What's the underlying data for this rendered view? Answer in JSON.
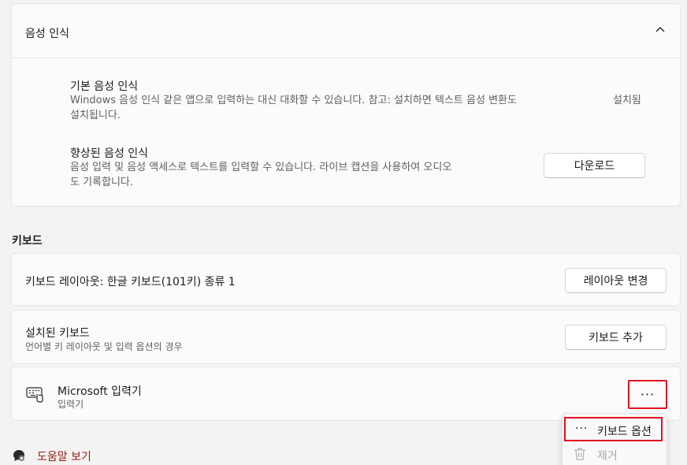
{
  "speech": {
    "title": "음성 인식",
    "basic": {
      "title": "기본 음성 인식",
      "desc": "Windows 음성 인식 같은 앱으로 입력하는 대신 대화할 수 있습니다. 참고: 설치하면 텍스트 음성 변환도",
      "status": "설치됨",
      "desc2": "설치됩니다."
    },
    "enhanced": {
      "title": "향상된 음성 인식",
      "desc": "음성 입력 및 음성 액세스로 텍스트를 입력할 수 있습니다. 라이브 캡션을 사용하여 오디오",
      "desc2": "도 기록합니다.",
      "button": "다운로드"
    }
  },
  "keyboard": {
    "section_label": "키보드",
    "layout": {
      "title": "키보드 레이아웃: 한글 키보드(101키) 종류 1",
      "button": "레이아웃 변경"
    },
    "installed": {
      "title": "설치된 키보드",
      "subtitle": "언어별 키 레이아웃 및 입력 옵션의 경우",
      "button": "키보드 추가"
    },
    "ime": {
      "title": "Microsoft 입력기",
      "subtitle": "입력기",
      "more": "···"
    }
  },
  "context_menu": {
    "options_glyph": "···",
    "options_label": "키보드 옵션",
    "remove_label": "제거"
  },
  "help": {
    "label": "도움말 보기"
  },
  "icons": [
    "chevron-up-icon",
    "keyboard-icon",
    "trash-icon",
    "help-icon"
  ],
  "colors": {
    "highlight": "#e3101e",
    "link": "#9b1c0e"
  }
}
